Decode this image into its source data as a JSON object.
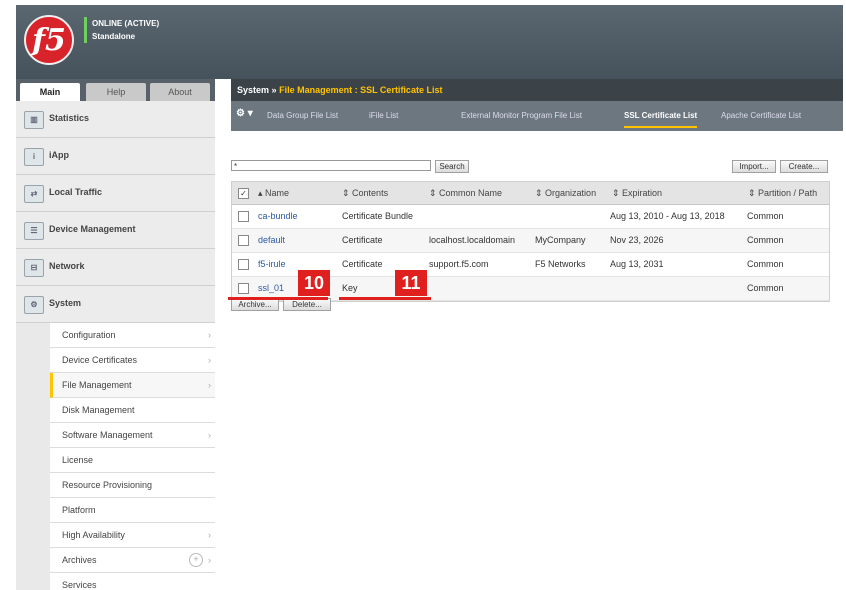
{
  "header": {
    "logo_text": "f5",
    "status_line1": "ONLINE (ACTIVE)",
    "status_line2": "Standalone"
  },
  "nav_tabs": [
    "Main",
    "Help",
    "About"
  ],
  "nav_items": [
    {
      "label": "Statistics",
      "icon": "chart-icon"
    },
    {
      "label": "iApp",
      "icon": "iapp-icon"
    },
    {
      "label": "Local Traffic",
      "icon": "traffic-icon"
    },
    {
      "label": "Device Management",
      "icon": "device-icon"
    },
    {
      "label": "Network",
      "icon": "network-icon"
    },
    {
      "label": "System",
      "icon": "system-icon"
    }
  ],
  "system_submenu": [
    {
      "label": "Configuration",
      "arrow": "›"
    },
    {
      "label": "Device Certificates",
      "arrow": "›"
    },
    {
      "label": "File Management",
      "arrow": "›"
    },
    {
      "label": "Disk Management",
      "arrow": ""
    },
    {
      "label": "Software Management",
      "arrow": "›"
    },
    {
      "label": "License",
      "arrow": ""
    },
    {
      "label": "Resource Provisioning",
      "arrow": ""
    },
    {
      "label": "Platform",
      "arrow": ""
    },
    {
      "label": "High Availability",
      "arrow": "›"
    },
    {
      "label": "Archives",
      "arrow": "›"
    },
    {
      "label": "Services",
      "arrow": ""
    }
  ],
  "breadcrumb": {
    "root": "System",
    "sep": "»",
    "path": "File Management : SSL Certificate List"
  },
  "subtabs": {
    "gear": "⚙ ▾",
    "items": [
      "Data Group File List",
      "iFile List",
      "External Monitor Program File List",
      "SSL Certificate List",
      "Apache Certificate List"
    ]
  },
  "search": {
    "value": "*",
    "button": "Search"
  },
  "actions": {
    "import": "Import...",
    "create": "Create..."
  },
  "table": {
    "columns": [
      "▴ Name",
      "⇕ Contents",
      "⇕ Common Name",
      "⇕ Organization",
      "⇕ Expiration",
      "⇕ Partition / Path"
    ],
    "rows": [
      {
        "name": "ca-bundle",
        "contents": "Certificate Bundle",
        "common_name": "",
        "organization": "",
        "expiration": "Aug 13, 2010 - Aug 13, 2018",
        "partition": "Common"
      },
      {
        "name": "default",
        "contents": "Certificate",
        "common_name": "localhost.localdomain",
        "organization": "MyCompany",
        "expiration": "Nov 23, 2026",
        "partition": "Common"
      },
      {
        "name": "f5-irule",
        "contents": "Certificate",
        "common_name": "support.f5.com",
        "organization": "F5 Networks",
        "expiration": "Aug 13, 2031",
        "partition": "Common"
      },
      {
        "name": "ssl_01",
        "contents": "Key",
        "common_name": "",
        "organization": "",
        "expiration": "",
        "partition": "Common"
      }
    ]
  },
  "bottom_buttons": {
    "archive": "Archive...",
    "delete": "Delete..."
  },
  "annotations": {
    "badge1": "10",
    "badge2": "11",
    "color": "#e0201e"
  }
}
